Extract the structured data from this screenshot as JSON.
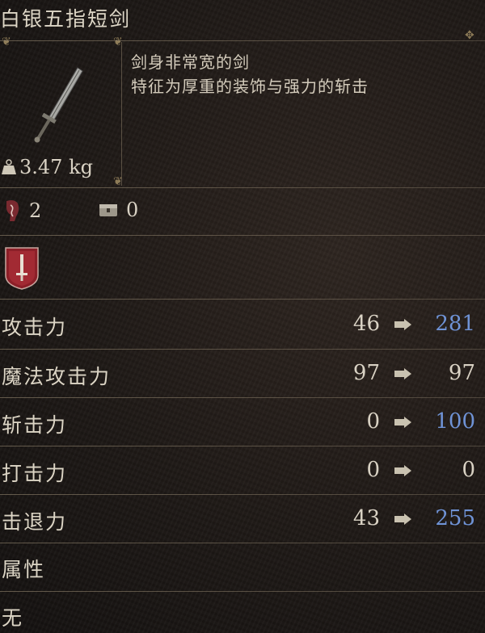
{
  "item": {
    "name": "白银五指短剑",
    "weight": "3.47 kg",
    "description": [
      "剑身非常宽的剑",
      "特征为厚重的装饰与强力的斩击"
    ]
  },
  "requirements": {
    "strength_value": "2",
    "slot_value": "0"
  },
  "stats": [
    {
      "label": "攻击力",
      "base": "46",
      "new": "281",
      "improved": true
    },
    {
      "label": "魔法攻击力",
      "base": "97",
      "new": "97",
      "improved": false
    },
    {
      "label": "斩击力",
      "base": "0",
      "new": "100",
      "improved": true
    },
    {
      "label": "打击力",
      "base": "0",
      "new": "0",
      "improved": false
    },
    {
      "label": "击退力",
      "base": "43",
      "new": "255",
      "improved": true
    }
  ],
  "attribute": {
    "label": "属性",
    "value": "无"
  },
  "colors": {
    "improved": "#6f93d6",
    "neutral": "#d9d2c4",
    "ornament": "#8e7c58",
    "badge": "#8c1f28"
  },
  "icons": {
    "weight": "weight-icon",
    "requirement": "strength-requirement-icon",
    "slot": "chest-slot-icon",
    "weapon": "dagger-icon",
    "badge": "sword-emblem-icon",
    "arrow": "arrow-right-icon"
  }
}
